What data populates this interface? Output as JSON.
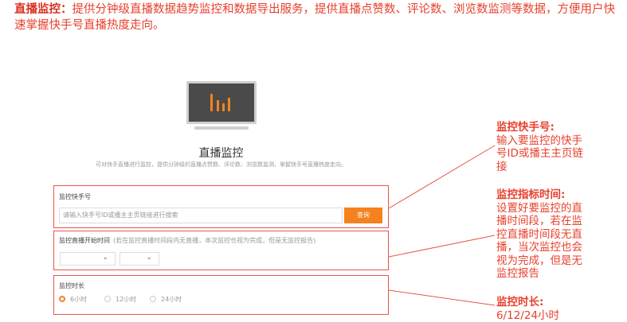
{
  "intro": {
    "heading": "直播监控：",
    "text": "提供分钟级直播数据趋势监控和数据导出服务，提供直播点赞数、评论数、浏览数监测等数据，方便用户快速掌握快手号直播热度走向。"
  },
  "page": {
    "title": "直播监控",
    "subtitle": "可对快手直播进行监控，提供分钟级的直播点赞数、评论数、浏览数监测，掌握快手号直播热度走向。"
  },
  "form": {
    "account_label": "监控快手号",
    "search_placeholder": "请输入快手号ID或播主主页链接进行搜索",
    "search_button": "查询",
    "start_time_label": "监控直播开始时间",
    "start_time_hint": "(若在监控直播时间段内无直播，本次监控也视为完成，但是无监控报告)",
    "date_value": "",
    "hour_value": "",
    "duration_label": "监控时长",
    "duration_options": [
      "6小时",
      "12小时",
      "24小时"
    ],
    "duration_selected": "6小时"
  },
  "annotations": [
    {
      "heading": "监控快手号:",
      "body": "输入要监控的快手号ID或播主主页链接"
    },
    {
      "heading": "监控指标时间:",
      "body": "设置好要监控的直播时间段，若在监控直播时间段无直播，当次监控也会视为完成，但是无监控报告"
    },
    {
      "heading": "监控时长:",
      "body": "6/12/24小时"
    }
  ],
  "colors": {
    "accent": "#f5821f",
    "annotation": "#e8402d",
    "box_border": "#e8554a"
  },
  "icons": [
    "bar-chart-monitor-icon",
    "chevron-down-icon",
    "radio-icon"
  ]
}
